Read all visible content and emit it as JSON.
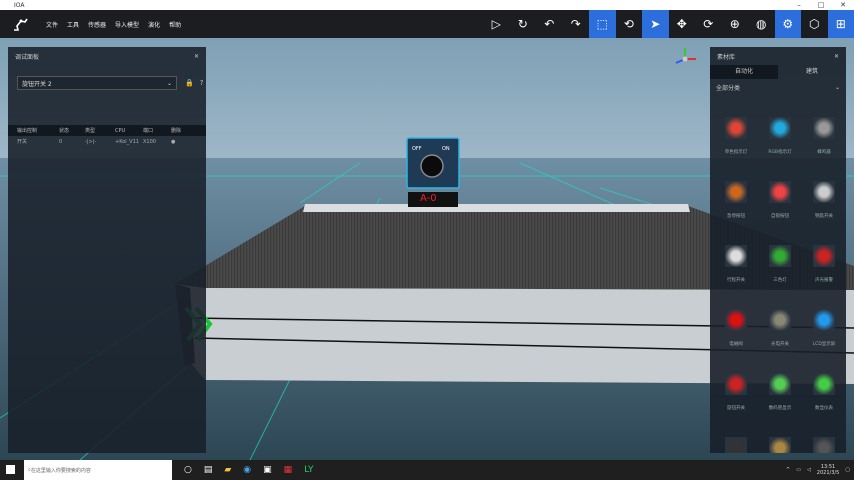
{
  "window": {
    "title": "IOA"
  },
  "menu": {
    "items": [
      "文件",
      "工具",
      "传感器",
      "导入模型",
      "演化",
      "帮助"
    ]
  },
  "toolbar": {
    "buttons": [
      {
        "icon": "play-icon"
      },
      {
        "icon": "refresh-icon"
      },
      {
        "icon": "undo-icon"
      },
      {
        "icon": "redo-icon"
      },
      {
        "icon": "select-region-icon",
        "active": true
      },
      {
        "icon": "camera-rotate-icon"
      },
      {
        "icon": "pointer-icon",
        "active": true
      },
      {
        "icon": "move-icon"
      },
      {
        "icon": "rotate-icon"
      },
      {
        "icon": "crosshair-icon"
      },
      {
        "icon": "globe-icon"
      },
      {
        "icon": "settings-icon",
        "active": true
      },
      {
        "icon": "cube-icon"
      },
      {
        "icon": "grid-icon",
        "active": true
      }
    ]
  },
  "left_panel": {
    "title": "调试面板",
    "select_value": "旋钮开关 2",
    "table": {
      "headers": [
        "输出控制",
        "状态",
        "类型",
        "CPU",
        "端口",
        "删除"
      ],
      "rows": [
        [
          "开关",
          "0",
          "-|>|-",
          "+Kol_V11",
          "X100"
        ]
      ]
    }
  },
  "right_panel": {
    "title": "素材库",
    "tabs": [
      "自动化",
      "建筑"
    ],
    "dropdown": "全部分类",
    "items": [
      {
        "label": "单色指示灯"
      },
      {
        "label": "RGB指示灯"
      },
      {
        "label": "蜂鸣器"
      },
      {
        "label": "急停按钮"
      },
      {
        "label": "自锁按钮"
      },
      {
        "label": "钥匙开关"
      },
      {
        "label": "行程开关"
      },
      {
        "label": "三色灯"
      },
      {
        "label": "声光报警"
      },
      {
        "label": "电磁阀"
      },
      {
        "label": "光电开关"
      },
      {
        "label": "LCD显示屏"
      },
      {
        "label": "旋钮开关"
      },
      {
        "label": "数码管显示"
      },
      {
        "label": "数显仪表"
      },
      {
        "label": "拨码开关"
      },
      {
        "label": "继电器"
      },
      {
        "label": "行程控制器"
      }
    ]
  },
  "scene": {
    "knob_off": "OFF",
    "knob_on": "ON",
    "display_value": "A-0"
  },
  "taskbar": {
    "search_placeholder": "在这里输入你要搜索的内容",
    "time": "13:51",
    "date": "2021/3/5"
  },
  "colors": {
    "accent": "#2c6fdc",
    "grid_line": "#22d6c8",
    "display_red": "#e8202a",
    "arrow_green": "#19c43a"
  }
}
